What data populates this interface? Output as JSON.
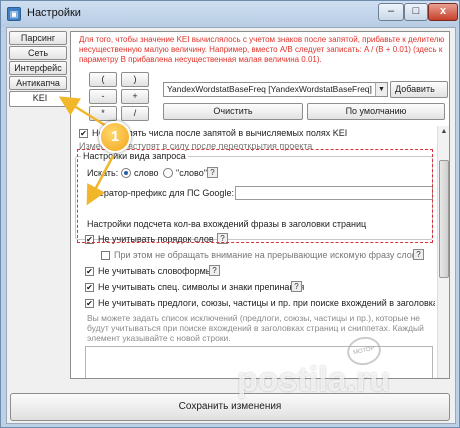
{
  "window": {
    "title": "Настройки",
    "min_label": "–",
    "max_label": "□",
    "close_label": "x"
  },
  "tabs": [
    {
      "label": "Парсинг"
    },
    {
      "label": "Сеть"
    },
    {
      "label": "Интерфейс"
    },
    {
      "label": "Антикапча"
    },
    {
      "label": "KEI",
      "active": true
    }
  ],
  "kei": {
    "hint": "Для того, чтобы значение KEI вычислялось с учетом знаков после запятой, прибавьте к делителю несущественную малую величину. Например, вместо A/B следует записать: A / (B + 0.01) (здесь к параметру B прибавлена несущественная малая величина 0.01).",
    "operator_buttons": [
      "(",
      ")",
      "-",
      "+",
      "*",
      "/"
    ],
    "param_select_value": "YandexWordstatBaseFreq [YandexWordstatBaseFreq]",
    "add_button": "Добавить",
    "clear_button": "Очистить",
    "default_button": "По умолчанию",
    "decimals_checkbox_label": "Не округлять числа после запятой в вычисляемых полях KEI",
    "decimals_checkbox_checked": true,
    "decimals_hint": "Изменения вступят в силу после переоткрытия проекта",
    "search_view": {
      "label": "Настройки вида запроса",
      "search_label": "Искать:",
      "options": [
        "слово",
        "\"слово\""
      ],
      "selected": "слово",
      "operator_prefix_label": "Оператор-префикс для ПС Google:",
      "operator_prefix_value": ""
    },
    "occurrence": {
      "label": "Настройки подсчета кол-ва вхождений фразы в заголовки страниц",
      "items": [
        {
          "label": "Не учитывать порядок слов",
          "checked": true
        },
        {
          "label": "При этом не обращать внимание на прерывающие искомую фразу слова",
          "checked": false
        },
        {
          "label": "Не учитывать словоформы",
          "checked": true
        },
        {
          "label": "Не учитывать спец. символы и знаки препинания",
          "checked": true
        },
        {
          "label": "Не учитывать предлоги, союзы, частицы и пр. при поиске вхождений в заголовках",
          "checked": true
        }
      ],
      "exclusions_hint": "Вы можете задать список исключений (предлоги, союзы, частицы и пр.), которые не будут учитываться при поиске вхождений в заголовках страниц и сниппетах. Каждый элемент указывайте с новой строки.",
      "exclusions_value": ""
    },
    "help_glyph": "?"
  },
  "footer": {
    "save_button": "Сохранить изменения"
  },
  "annotation": {
    "step": "1",
    "accent_color": "#d9323a"
  },
  "watermark": {
    "text": "postila.ru",
    "stamp": "МОТОР"
  }
}
